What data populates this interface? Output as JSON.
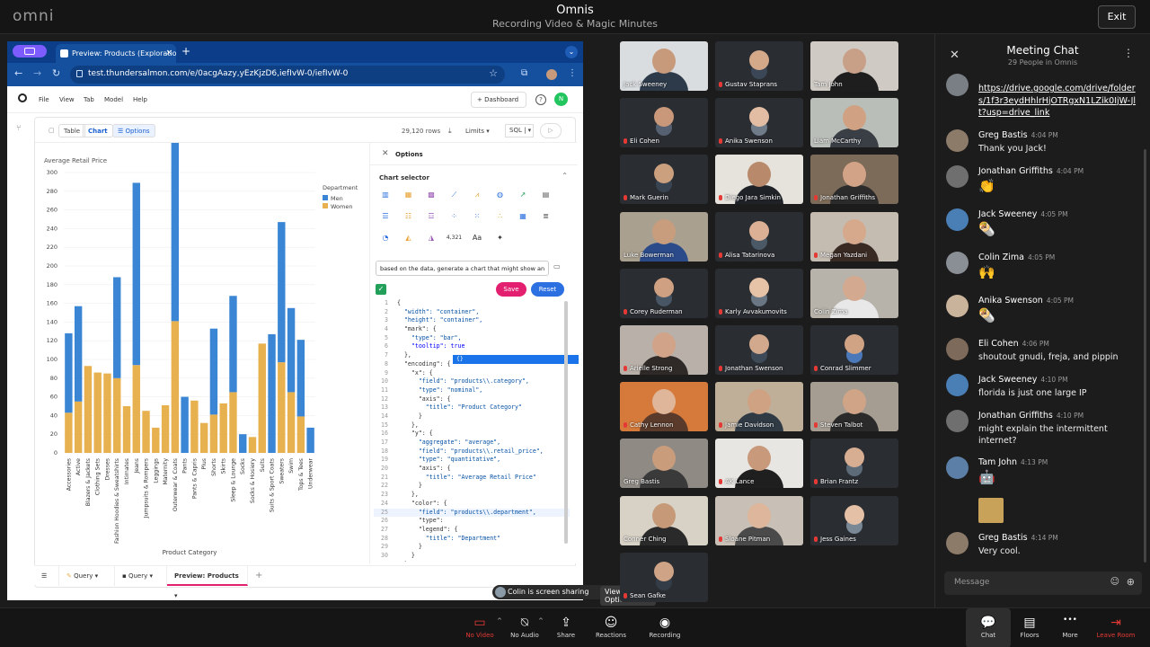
{
  "meeting": {
    "logo": "omni",
    "title": "Omnis",
    "subtitle": "Recording Video & Magic Minutes",
    "exit_label": "Exit"
  },
  "browser": {
    "tab_title": "Preview: Products (Exploratio",
    "url": "test.thundersalmon.com/e/0acgAazy,yEzKjzD6,iefIvW-0/iefIvW-0"
  },
  "omni_app": {
    "menus": [
      "File",
      "View",
      "Tab",
      "Model",
      "Help"
    ],
    "dashboard_label": "Dashboard",
    "help_label": "?",
    "avatar_initial": "N",
    "view_tabs": [
      "Table",
      "Chart",
      "Options"
    ],
    "rows": "29,120 rows",
    "limits": "Limits",
    "sql": "SQL"
  },
  "chart_data": {
    "type": "bar",
    "title": "Average Retail Price",
    "xlabel": "Product Category",
    "ylabel": "",
    "ylim": [
      0,
      300
    ],
    "yticks": [
      0,
      20,
      40,
      60,
      80,
      100,
      120,
      140,
      160,
      180,
      200,
      220,
      240,
      260,
      280,
      300
    ],
    "legend_title": "Department",
    "legend_position": "top-right",
    "categories": [
      "Accessories",
      "Active",
      "Blazers & Jackets",
      "Clothing Sets",
      "Dresses",
      "Fashion Hoodies & Sweatshirts",
      "Intimates",
      "Jeans",
      "Jumpsuits & Rompers",
      "Leggings",
      "Maternity",
      "Outerwear & Coats",
      "Pants",
      "Pants & Capris",
      "Plus",
      "Shorts",
      "Skirts",
      "Sleep & Lounge",
      "Socks",
      "Socks & Hosiery",
      "Suits",
      "Suits & Sport Coats",
      "Sweaters",
      "Swim",
      "Tops & Tees",
      "Underwear"
    ],
    "series": [
      {
        "name": "Men",
        "color": "#3b86d4",
        "values": [
          85,
          102,
          0,
          0,
          0,
          108,
          0,
          195,
          0,
          0,
          0,
          290,
          60,
          0,
          0,
          92,
          0,
          103,
          20,
          0,
          0,
          127,
          150,
          90,
          82,
          27
        ]
      },
      {
        "name": "Women",
        "color": "#e8b14f",
        "values": [
          43,
          55,
          93,
          86,
          85,
          80,
          50,
          94,
          45,
          27,
          51,
          141,
          0,
          56,
          32,
          41,
          53,
          65,
          0,
          17,
          117,
          0,
          97,
          65,
          39,
          0
        ]
      }
    ]
  },
  "options_panel": {
    "title": "Options",
    "chart_selector": "Chart selector",
    "prompt": "based on the data, generate a chart that might show an",
    "save": "Save",
    "reset": "Reset",
    "number_icon": "4,321",
    "text_icon": "Aa",
    "code_lines": [
      "{",
      "  \"width\": \"container\",",
      "  \"height\": \"container\",",
      "  \"mark\": {",
      "    \"type\": \"bar\",",
      "    \"tooltip\": true",
      "  },",
      "  \"encoding\": {",
      "    \"x\": {",
      "      \"field\": \"products\\\\.category\",",
      "      \"type\": \"nominal\",",
      "      \"axis\": {",
      "        \"title\": \"Product Category\"",
      "      }",
      "    },",
      "    \"y\": {",
      "      \"aggregate\": \"average\",",
      "      \"field\": \"products\\\\.retail_price\",",
      "      \"type\": \"quantitative\",",
      "      \"axis\": {",
      "        \"title\": \"Average Retail Price\"",
      "      }",
      "    },",
      "    \"color\": {",
      "      \"field\": \"products\\\\.department\",",
      "      \"type\": ",
      "      \"legend\": {",
      "        \"title\": \"Department\"",
      "      }",
      "    }",
      "  }"
    ],
    "autocomplete": "{}"
  },
  "workbook_tabs": [
    "Query",
    "Query",
    "Preview: Products"
  ],
  "share_banner": {
    "text": "Colin is screen sharing",
    "options": "View Options"
  },
  "participants": [
    {
      "name": "Jack Sweeney",
      "muted": false,
      "bg": "#d9dde0",
      "skin": "#c79a7c",
      "shirt": "#2d3a4a"
    },
    {
      "name": "Gustav Staprans",
      "muted": true,
      "bg": "#2a2e33",
      "skin": "#d4a98a",
      "shirt": "#3b4756"
    },
    {
      "name": "Tam John",
      "muted": false,
      "bg": "#cfcac4",
      "skin": "#c8a088",
      "shirt": "#1e1e1e"
    },
    {
      "name": "Eli Cohen",
      "muted": true,
      "bg": "#2a2e33",
      "skin": "#c9977a",
      "shirt": "#556070"
    },
    {
      "name": "Anika Swenson",
      "muted": true,
      "bg": "#2a2e33",
      "skin": "#e2bda3",
      "shirt": "#6f7b88"
    },
    {
      "name": "Liam McCarthy",
      "muted": false,
      "bg": "#b9beb8",
      "skin": "#d0a283",
      "shirt": "#3a3f46"
    },
    {
      "name": "Mark Guerin",
      "muted": true,
      "bg": "#2a2e33",
      "skin": "#caa07f",
      "shirt": "#394452"
    },
    {
      "name": "Diego Jara Simkin",
      "muted": true,
      "bg": "#e6e2dc",
      "skin": "#b8896a",
      "shirt": "#1f2328"
    },
    {
      "name": "Jonathan Griffiths",
      "muted": true,
      "bg": "#7c6b58",
      "skin": "#d2a386",
      "shirt": "#2b2b2b"
    },
    {
      "name": "Luke Bowerman",
      "muted": false,
      "bg": "#a9a08f",
      "skin": "#c79d7e",
      "shirt": "#2a4a8a"
    },
    {
      "name": "Alisa Tatarinova",
      "muted": true,
      "bg": "#2a2e33",
      "skin": "#dcb095",
      "shirt": "#4b5967"
    },
    {
      "name": "Megan Yazdani",
      "muted": true,
      "bg": "#c4bbb1",
      "skin": "#d6a98c",
      "shirt": "#3a2a24"
    },
    {
      "name": "Corey Ruderman",
      "muted": true,
      "bg": "#2a2e33",
      "skin": "#cfa081",
      "shirt": "#485565"
    },
    {
      "name": "Karly Avvakumovits",
      "muted": true,
      "bg": "#2a2e33",
      "skin": "#e6c2a7",
      "shirt": "#6b7684"
    },
    {
      "name": "Colin Zima",
      "muted": false,
      "bg": "#b7b3aa",
      "skin": "#d3aa90",
      "shirt": "#e8e8e8"
    },
    {
      "name": "Arielle Strong",
      "muted": true,
      "bg": "#b9b1a9",
      "skin": "#d1a388",
      "shirt": "#2f2a28"
    },
    {
      "name": "Jonathan Swenson",
      "muted": true,
      "bg": "#2a2e33",
      "skin": "#d3a98d",
      "shirt": "#3e4a58"
    },
    {
      "name": "Conrad Slimmer",
      "muted": true,
      "bg": "#2a2e33",
      "skin": "#cfa384",
      "shirt": "#4a78b8"
    },
    {
      "name": "Cathy Lennon",
      "muted": true,
      "bg": "#d57a3a",
      "skin": "#e0b69a",
      "shirt": "#5a3a2a"
    },
    {
      "name": "Jamie Davidson",
      "muted": true,
      "bg": "#bfae98",
      "skin": "#cfa283",
      "shirt": "#2f3a45"
    },
    {
      "name": "Steven Talbot",
      "muted": true,
      "bg": "#a59d92",
      "skin": "#d0a486",
      "shirt": "#2a2a2a"
    },
    {
      "name": "Greg Bastis",
      "muted": false,
      "bg": "#8f8a84",
      "skin": "#c99c7c",
      "shirt": "#3a3a3a"
    },
    {
      "name": "AK Lance",
      "muted": true,
      "bg": "#e8e6e2",
      "skin": "#c89a7b",
      "shirt": "#1f1f1f"
    },
    {
      "name": "Brian Frantz",
      "muted": true,
      "bg": "#2a2e33",
      "skin": "#d8ae92",
      "shirt": "#5d6b79"
    },
    {
      "name": "Conner Ching",
      "muted": false,
      "bg": "#d8d2c6",
      "skin": "#c69a78",
      "shirt": "#2a2a2a"
    },
    {
      "name": "Sloane Pitman",
      "muted": true,
      "bg": "#c8c0b6",
      "skin": "#ddb69b",
      "shirt": "#4a4a4a"
    },
    {
      "name": "Jess Gaines",
      "muted": true,
      "bg": "#2a2e33",
      "skin": "#e4c0a6",
      "shirt": "#7a8795"
    },
    {
      "name": "Sean Gafke",
      "muted": true,
      "bg": "#2a2e33",
      "skin": "#cfa386",
      "shirt": "#333c47"
    }
  ],
  "chat": {
    "title": "Meeting Chat",
    "subtitle": "29 People in Omnis",
    "link": "https://drive.google.com/drive/folders/1f3r3eydHhlrHjOTRgxN1LZik0IjW-Jlt?usp=drive_link",
    "messages": [
      {
        "name": "Greg Bastis",
        "time": "4:04 PM",
        "text": "Thank you Jack!"
      },
      {
        "name": "Jonathan Griffiths",
        "time": "4:04 PM",
        "emoji": "👏"
      },
      {
        "name": "Jack Sweeney",
        "time": "4:05 PM",
        "emoji": "🌯"
      },
      {
        "name": "Colin Zima",
        "time": "4:05 PM",
        "emoji": "🙌"
      },
      {
        "name": "Anika Swenson",
        "time": "4:05 PM",
        "emoji": "🌯"
      },
      {
        "name": "Eli Cohen",
        "time": "4:06 PM",
        "text": "shoutout gnudi, freja, and pippin"
      },
      {
        "name": "Jack Sweeney",
        "time": "4:10 PM",
        "text": "florida is just one large IP"
      },
      {
        "name": "Jonathan Griffiths",
        "time": "4:10 PM",
        "text": "might explain the intermittent internet?"
      },
      {
        "name": "Tam John",
        "time": "4:13 PM",
        "emoji": "🤖"
      },
      {
        "name": "Greg Bastis",
        "time": "4:14 PM",
        "text": "Very cool."
      }
    ],
    "input_placeholder": "Message"
  },
  "controls": [
    {
      "label": "No Video",
      "icon": "video-off-icon",
      "glyph": "▭",
      "red": true
    },
    {
      "label": "No Audio",
      "icon": "mic-off-icon",
      "glyph": "⍉",
      "red": false
    },
    {
      "label": "Share",
      "icon": "share-icon",
      "glyph": "⇪",
      "red": false
    },
    {
      "label": "Reactions",
      "icon": "reactions-icon",
      "glyph": "☺",
      "red": false
    },
    {
      "label": "Recording",
      "icon": "recording-icon",
      "glyph": "◉",
      "red": false
    },
    {
      "label": "Chat",
      "icon": "chat-icon",
      "glyph": "💬",
      "red": false
    },
    {
      "label": "Floors",
      "icon": "floors-icon",
      "glyph": "▤",
      "red": false
    },
    {
      "label": "More",
      "icon": "more-icon",
      "glyph": "•••",
      "red": false
    },
    {
      "label": "Leave Room",
      "icon": "leave-icon",
      "glyph": "⇥",
      "red": true
    }
  ]
}
